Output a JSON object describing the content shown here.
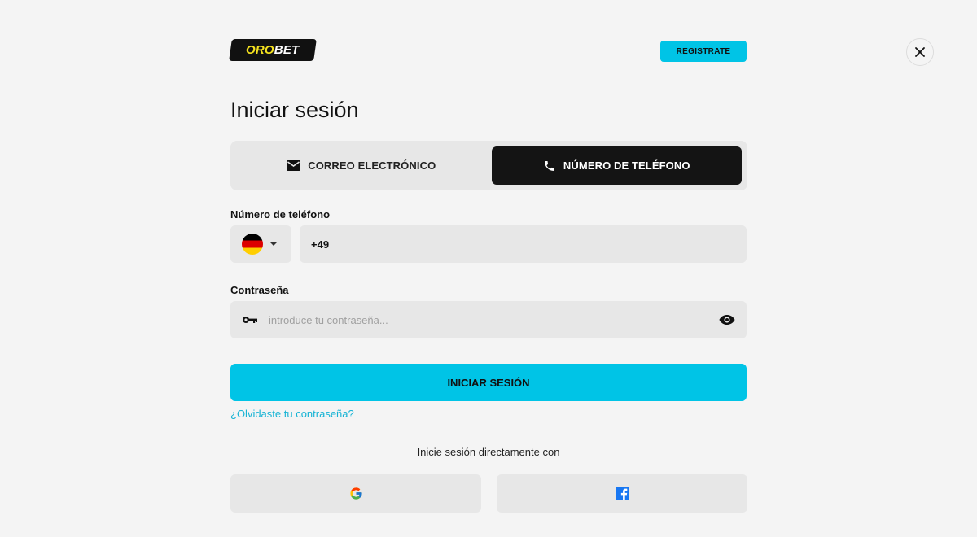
{
  "brand": {
    "logo_part1": "ORO",
    "logo_part2": "BET",
    "logo_colors": {
      "oro": "#f5e21f",
      "bet": "#ffffff",
      "background": "#111111"
    }
  },
  "header": {
    "register_label": "REGISTRATE",
    "close_icon": "close-icon"
  },
  "title": "Iniciar sesión",
  "tabs": [
    {
      "label": "CORREO ELECTRÓNICO",
      "icon": "mail-icon",
      "active": false
    },
    {
      "label": "NÚMERO DE TELÉFONO",
      "icon": "phone-icon",
      "active": true
    }
  ],
  "phone": {
    "label": "Número de teléfono",
    "country_flag": "germany-flag-icon",
    "value": "+49"
  },
  "password": {
    "label": "Contraseña",
    "placeholder": "introduce tu contraseña...",
    "left_icon": "key-icon",
    "right_icon": "eye-icon"
  },
  "submit_label": "INICIAR SESIÓN",
  "forgot_label": "¿Olvidaste tu contraseña?",
  "social": {
    "caption": "Inicie sesión directamente con",
    "providers": [
      "google-icon",
      "facebook-icon"
    ]
  },
  "colors": {
    "accent": "#00c4e6",
    "link": "#16b3d4",
    "background": "#f4f4f4",
    "field": "#e7e7e7",
    "active_tab": "#141414"
  }
}
